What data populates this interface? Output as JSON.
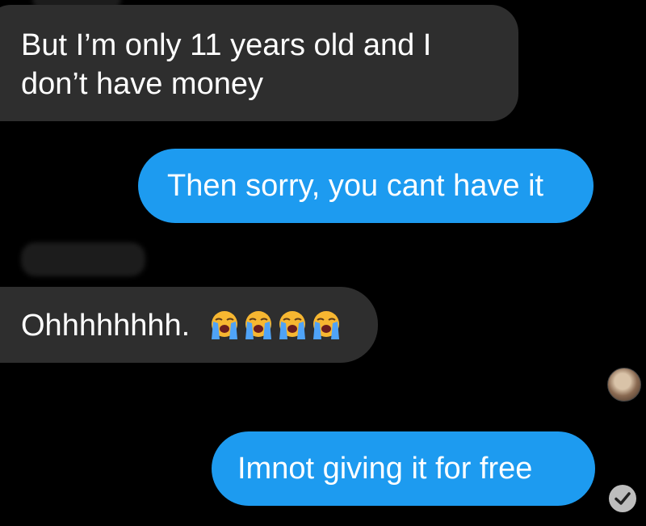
{
  "conversation": {
    "messages": [
      {
        "direction": "incoming",
        "text_line1": "But I’m only 11 years old and I",
        "text_line2": "don’t have money"
      },
      {
        "direction": "outgoing",
        "text": "Then sorry, you cant have it"
      },
      {
        "direction": "incoming",
        "text": "Ohhhhhhhh.",
        "emoji_count": 4,
        "emoji": "loudly-crying-face-icon"
      },
      {
        "direction": "outgoing",
        "text": "Imnot giving it for free"
      }
    ]
  },
  "colors": {
    "background": "#000000",
    "incoming_bubble": "#2e2e2e",
    "outgoing_bubble": "#1d9bf0",
    "text": "#ffffff"
  },
  "status": {
    "read_receipt_icon": "check-circle-icon",
    "avatar_icon": "avatar"
  }
}
